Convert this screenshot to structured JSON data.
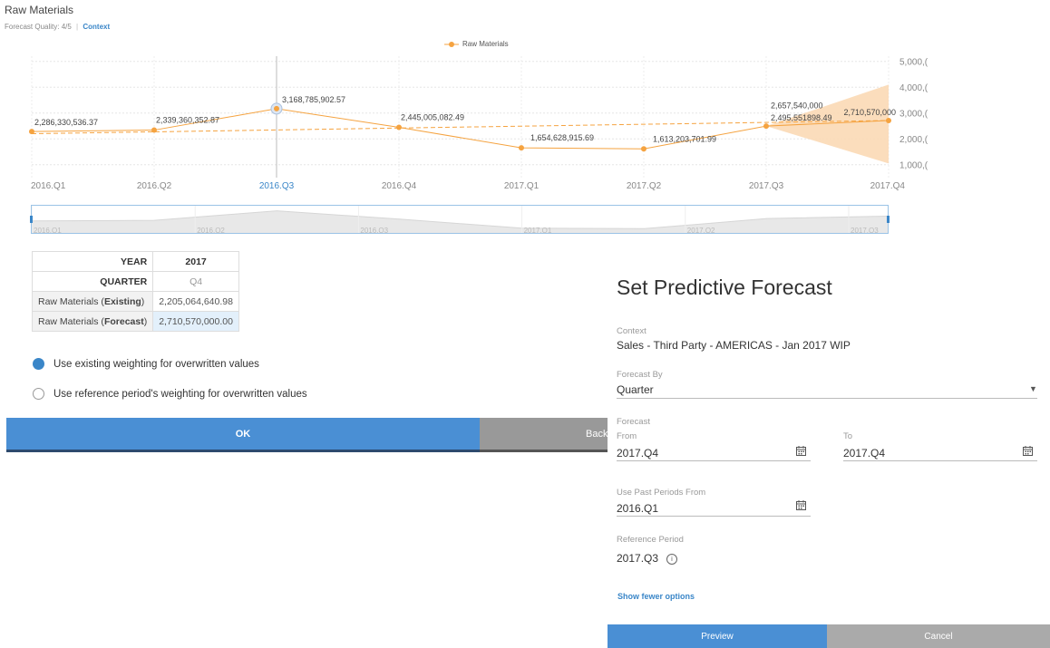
{
  "header": {
    "title": "Raw Materials",
    "quality": "Forecast Quality: 4/5",
    "separator": "|",
    "context_link": "Context"
  },
  "colors": {
    "accent": "#f5a340",
    "band": "#fbd9b5",
    "blue": "#3a86c8"
  },
  "chart_data": {
    "type": "line",
    "legend": [
      "Raw Materials"
    ],
    "legend_position": "top-center",
    "categories": [
      "2016.Q1",
      "2016.Q2",
      "2016.Q3",
      "2016.Q4",
      "2017.Q1",
      "2017.Q2",
      "2017.Q3",
      "2017.Q4"
    ],
    "highlighted_category": "2016.Q3",
    "series": [
      {
        "name": "Raw Materials",
        "values": [
          2286330536.37,
          2339360352.87,
          3168785902.57,
          2445005082.49,
          1654628915.69,
          1613203701.99,
          2495551898.49,
          2710570000
        ],
        "labels": [
          "2,286,330,536.37",
          "2,339,360,352.87",
          "3,168,785,902.57",
          "2,445,005,082.49",
          "1,654,628,915.69",
          "1,613,203,701.99",
          "2,495,551898.49",
          "2,710,570,000"
        ]
      }
    ],
    "trend": {
      "x": [
        "2016.Q1",
        "2017.Q4"
      ],
      "values": [
        2200000000,
        2710570000
      ]
    },
    "forecast_extra_label": {
      "x": "2017.Q3",
      "value": 2657540000,
      "text": "2,657,540,000"
    },
    "confidence_band": {
      "x": [
        "2017.Q3",
        "2017.Q4"
      ],
      "lower": [
        2495551898.49,
        1050000000
      ],
      "upper": [
        2495551898.49,
        4100000000
      ]
    },
    "y_ticks": [
      1000000000,
      2000000000,
      3000000000,
      4000000000,
      5000000000
    ],
    "y_tick_labels": [
      "1,000,(",
      "2,000,(",
      "3,000,(",
      "4,000,(",
      "5,000,("
    ],
    "ylim": [
      500000000,
      5200000000
    ],
    "grid": true,
    "navigator_labels": [
      "2016.Q1",
      "2016.Q2",
      "2016.Q3",
      "2017.Q1",
      "2017.Q2",
      "2017.Q3"
    ]
  },
  "table": {
    "year_label": "YEAR",
    "year": "2017",
    "quarter_label": "QUARTER",
    "quarter": "Q4",
    "existing_prefix": "Raw Materials (",
    "existing_bold": "Existing",
    "suffix": ")",
    "existing_value": "2,205,064,640.98",
    "forecast_prefix": "Raw Materials (",
    "forecast_bold": "Forecast",
    "forecast_value": "2,710,570,000.00"
  },
  "options": {
    "existing_weighting": "Use existing weighting for overwritten values",
    "reference_weighting": "Use reference period's weighting for overwritten values"
  },
  "buttons": {
    "ok": "OK",
    "back": "Back"
  },
  "panel": {
    "title": "Set Predictive Forecast",
    "context_label": "Context",
    "context_value": "Sales - Third Party - AMERICAS - Jan 2017 WIP",
    "forecast_by_label": "Forecast By",
    "forecast_by_value": "Quarter",
    "forecast_label": "Forecast",
    "from_label": "From",
    "from_value": "2017.Q4",
    "to_label": "To",
    "to_value": "2017.Q4",
    "past_label": "Use Past Periods From",
    "past_value": "2016.Q1",
    "reference_label": "Reference Period",
    "reference_value": "2017.Q3",
    "fewer_options": "Show fewer options",
    "preview": "Preview",
    "cancel": "Cancel"
  }
}
